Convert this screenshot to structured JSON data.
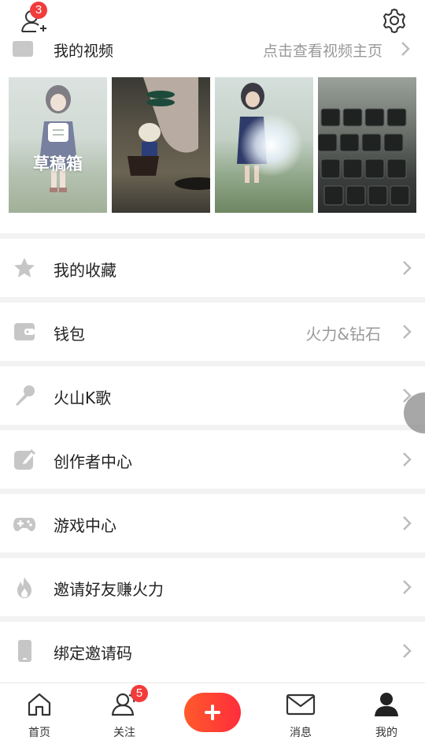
{
  "top_bar": {
    "friend_badge": "3"
  },
  "videos": {
    "label": "我的视频",
    "hint": "点击查看视频主页",
    "draft_label": "草稿箱"
  },
  "menu": [
    {
      "label": "我的收藏",
      "icon": "star-icon",
      "value": ""
    },
    {
      "label": "钱包",
      "icon": "wallet-icon",
      "value": "火力&钻石"
    },
    {
      "label": "火山K歌",
      "icon": "microphone-icon",
      "value": ""
    },
    {
      "label": "创作者中心",
      "icon": "edit-icon",
      "value": ""
    },
    {
      "label": "游戏中心",
      "icon": "gamepad-icon",
      "value": ""
    },
    {
      "label": "邀请好友赚火力",
      "icon": "flame-icon",
      "value": ""
    },
    {
      "label": "绑定邀请码",
      "icon": "phone-icon",
      "value": ""
    }
  ],
  "bottom_nav": {
    "home": "首页",
    "follow": "关注",
    "follow_badge": "5",
    "messages": "消息",
    "me": "我的"
  },
  "colors": {
    "accent": "#ff3b30",
    "badge": "#f23b3b",
    "icon_gray": "#c6c6c6",
    "text": "#222222",
    "muted": "#9a9a9a"
  }
}
